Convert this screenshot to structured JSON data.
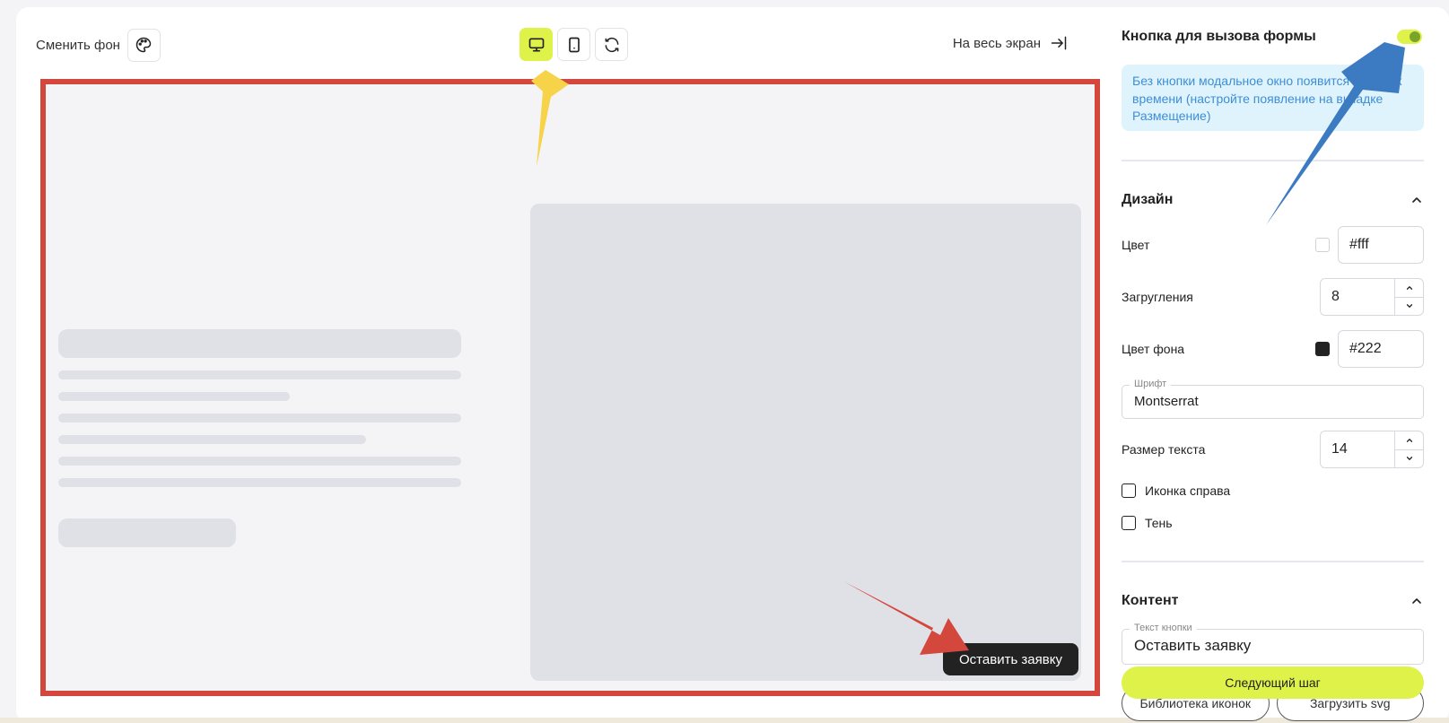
{
  "toolbar": {
    "bg_switch_label": "Сменить фон",
    "fullscreen_label": "На весь экран",
    "device_buttons": [
      "desktop-icon",
      "mobile-icon",
      "refresh-icon"
    ]
  },
  "preview": {
    "cta_label": "Оставить заявку"
  },
  "panel": {
    "title": "Кнопка для вызова формы",
    "toggle_on": true,
    "info_text": "Без кнопки модальное окно появится через хх времени (настройте появление на вкладке Размещение)",
    "design": {
      "title": "Дизайн",
      "color_label": "Цвет",
      "color_value": "#fff",
      "radius_label": "Загругления",
      "radius_value": "8",
      "bg_label": "Цвет фона",
      "bg_value": "#222",
      "font_legend": "Шрифт",
      "font_value": "Montserrat",
      "text_size_label": "Размер текста",
      "text_size_value": "14",
      "icon_right_label": "Иконка справа",
      "shadow_label": "Тень"
    },
    "content": {
      "title": "Контент",
      "button_text_legend": "Текст кнопки",
      "button_text_value": "Оставить заявку",
      "icon_library_label": "Библиотека иконок",
      "upload_svg_label": "Загрузить svg"
    },
    "next_label": "Следующий шаг"
  },
  "colors": {
    "accent": "#dff24a",
    "frame_highlight": "#d4473d",
    "info_bg": "#dff3fc",
    "info_text": "#3d8ed7",
    "arrow_yellow": "#f7d34a",
    "arrow_blue": "#3c7bc2",
    "arrow_red": "#d4473d"
  }
}
